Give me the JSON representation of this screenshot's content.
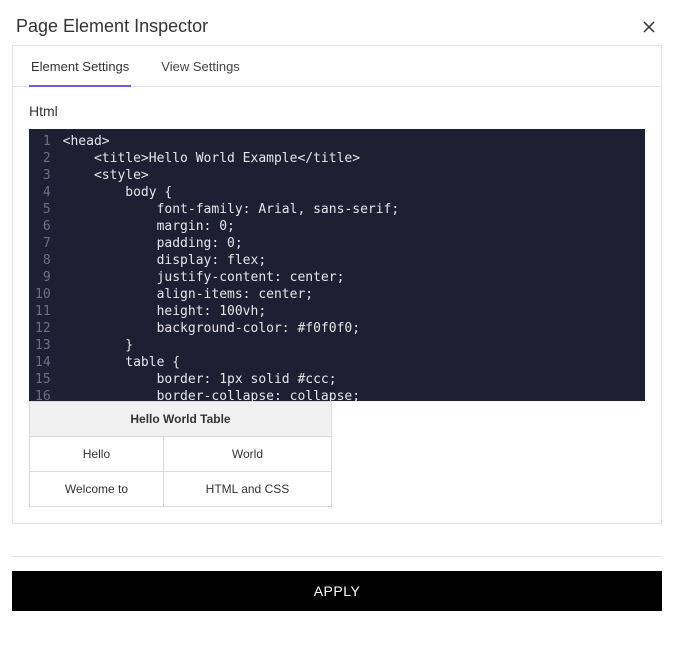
{
  "header": {
    "title": "Page Element Inspector"
  },
  "tabs": [
    {
      "label": "Element Settings",
      "active": true
    },
    {
      "label": "View Settings",
      "active": false
    }
  ],
  "fieldLabel": "Html",
  "code": {
    "lines": [
      "<head>",
      "    <title>Hello World Example</title>",
      "    <style>",
      "        body {",
      "            font-family: Arial, sans-serif;",
      "            margin: 0;",
      "            padding: 0;",
      "            display: flex;",
      "            justify-content: center;",
      "            align-items: center;",
      "            height: 100vh;",
      "            background-color: #f0f0f0;",
      "        }",
      "        table {",
      "            border: 1px solid #ccc;",
      "            border-collapse: collapse;"
    ]
  },
  "previewTable": {
    "header": "Hello World Table",
    "rows": [
      [
        "Hello",
        "World"
      ],
      [
        "Welcome to",
        "HTML and CSS"
      ]
    ]
  },
  "buttons": {
    "apply": "APPLY"
  }
}
